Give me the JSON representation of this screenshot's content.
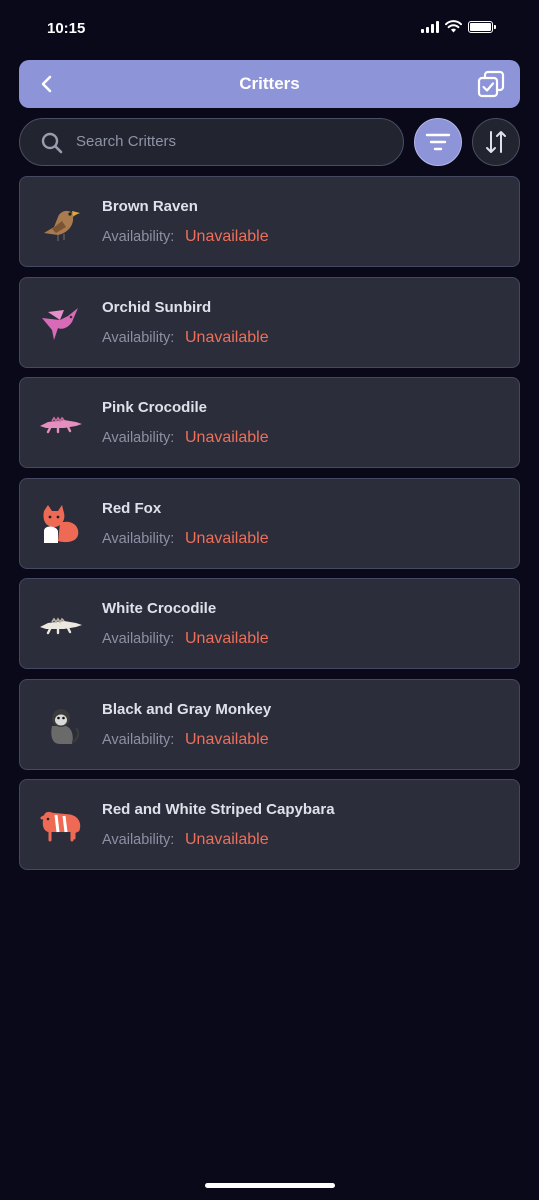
{
  "status_bar": {
    "time": "10:15"
  },
  "header": {
    "title": "Critters"
  },
  "search": {
    "placeholder": "Search Critters"
  },
  "availability_label": "Availability:",
  "colors": {
    "accent": "#8e94d8",
    "unavailable": "#ee6f5a",
    "card_bg": "#2b2d3a",
    "page_bg": "#09091a"
  },
  "critters": [
    {
      "name": "Brown Raven",
      "status": "Unavailable",
      "icon": "raven-icon"
    },
    {
      "name": "Orchid Sunbird",
      "status": "Unavailable",
      "icon": "hummingbird-icon"
    },
    {
      "name": "Pink Crocodile",
      "status": "Unavailable",
      "icon": "crocodile-icon"
    },
    {
      "name": "Red Fox",
      "status": "Unavailable",
      "icon": "fox-icon"
    },
    {
      "name": "White Crocodile",
      "status": "Unavailable",
      "icon": "crocodile-icon"
    },
    {
      "name": "Black and Gray Monkey",
      "status": "Unavailable",
      "icon": "monkey-icon"
    },
    {
      "name": "Red and White Striped Capybara",
      "status": "Unavailable",
      "icon": "capybara-icon"
    }
  ]
}
